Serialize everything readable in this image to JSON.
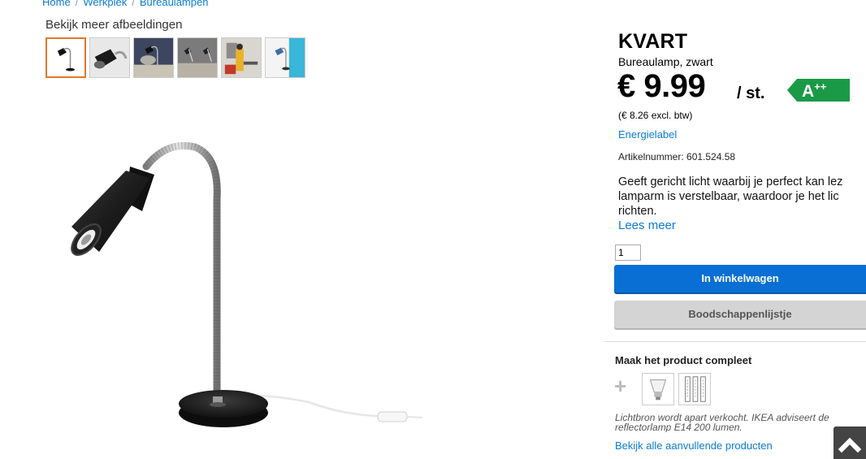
{
  "breadcrumb": {
    "home": "Home",
    "category": "Werkplek",
    "subcategory": "Bureaulampen"
  },
  "gallery": {
    "more_images_label": "Bekijk meer afbeeldingen"
  },
  "product": {
    "name": "KVART",
    "subtitle": "Bureaulamp, zwart",
    "price": "€ 9.99",
    "unit": "/ st.",
    "energy_class": "A++",
    "price_excl": "(€ 8.26 excl. btw)",
    "energy_label_link": "Energielabel",
    "article_number": "Artikelnummer: 601.524.58",
    "description_lines": [
      "Geeft gericht licht waarbij je perfect kan lez",
      "lamparm is verstelbaar, waardoor je het lic",
      "richten."
    ],
    "read_more": "Lees meer"
  },
  "purchase": {
    "quantity": "1",
    "add_to_cart": "In winkelwagen",
    "shopping_list": "Boodschappenlijstje"
  },
  "complete": {
    "title": "Maak het product compleet",
    "plus": "+",
    "note_lines": [
      "Lichtbron wordt apart verkocht. IKEA adviseert de",
      "reflectorlamp E14 200 lumen."
    ],
    "all_link": "Bekijk alle aanvullende producten"
  },
  "colors": {
    "link": "#0a7bd4",
    "cart_button": "#0a6fd4",
    "energy_green": "#1a9a47",
    "thumb_active": "#e0782a"
  }
}
